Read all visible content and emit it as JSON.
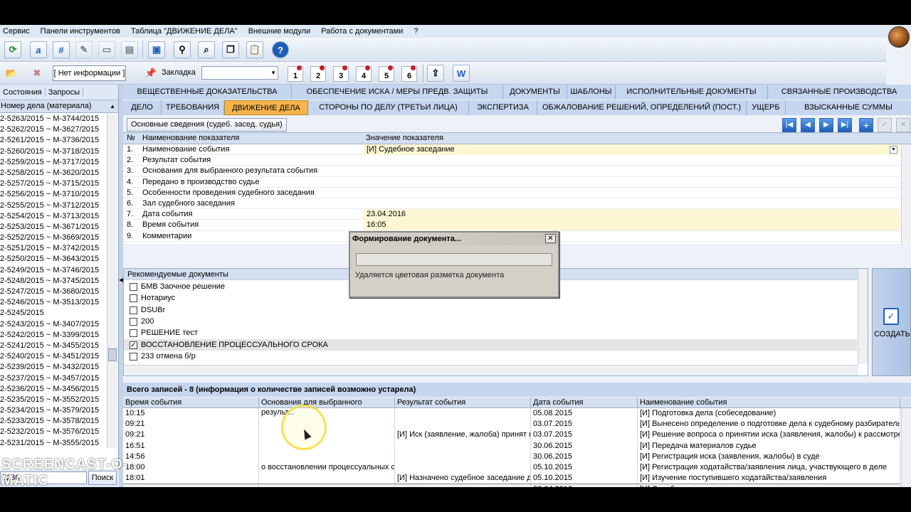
{
  "menu": [
    "Сервис",
    "Панели инструментов",
    "Таблица \"ДВИЖЕНИЕ ДЕЛА\"",
    "Внешние модули",
    "Работа с документами",
    "?"
  ],
  "toolbar": {
    "no_info": "[ Нет информации ]",
    "bookmark_label": "Закладка",
    "bookmark_value": "",
    "pin_numbers": [
      "1",
      "2",
      "3",
      "4",
      "5",
      "6"
    ]
  },
  "left": {
    "tabs": [
      "Состояния",
      "Запросы"
    ],
    "header": "Номер дела (материала)",
    "items": [
      "2-5263/2015 ~ М-3744/2015",
      "2-5262/2015 ~ М-3627/2015",
      "2-5261/2015 ~ М-3736/2015",
      "2-5260/2015 ~ М-3718/2015",
      "2-5259/2015 ~ М-3717/2015",
      "2-5258/2015 ~ М-3620/2015",
      "2-5257/2015 ~ М-3715/2015",
      "2-5256/2015 ~ М-3710/2015",
      "2-5255/2015 ~ М-3712/2015",
      "2-5254/2015 ~ М-3713/2015",
      "2-5253/2015 ~ М-3671/2015",
      "2-5252/2015 ~ М-3669/2015",
      "2-5251/2015 ~ М-3742/2015",
      "2-5250/2015 ~ М-3643/2015",
      "2-5249/2015 ~ М-3746/2015",
      "2-5248/2015 ~ М-3745/2015",
      "2-5247/2015 ~ М-3680/2015",
      "2-5246/2015 ~ М-3513/2015",
      "2-5245/2015",
      "2-5243/2015 ~ М-3407/2015",
      "2-5242/2015 ~ М-3399/2015",
      "2-5241/2015 ~ М-3455/2015",
      "2-5240/2015 ~ М-3451/2015",
      "2-5239/2015 ~ М-3432/2015",
      "2-5237/2015 ~ М-3457/2015",
      "2-5236/2015 ~ М-3456/2015",
      "2-5235/2015 ~ М-3552/2015",
      "2-5234/2015 ~ М-3579/2015",
      "2-5233/2015 ~ М-3578/2015",
      "2-5232/2015 ~ М-3576/2015",
      "2-5231/2015 ~ М-3555/2015",
      "2-5230/2015"
    ],
    "search_value": "5230",
    "search_button": "Поиск"
  },
  "tabs_row1": [
    "ВЕЩЕСТВЕННЫЕ ДОКАЗАТЕЛЬСТВА",
    "ОБЕСПЕЧЕНИЕ ИСКА / МЕРЫ ПРЕДВ. ЗАЩИТЫ",
    "ДОКУМЕНТЫ",
    "ШАБЛОНЫ",
    "ИСПОЛНИТЕЛЬНЫЕ ДОКУМЕНТЫ",
    "СВЯЗАННЫЕ ПРОИЗВОДСТВА"
  ],
  "tabs_row2": [
    "ДЕЛО",
    "ТРЕБОВАНИЯ",
    "ДВИЖЕНИЕ ДЕЛА",
    "СТОРОНЫ ПО ДЕЛУ (ТРЕТЬИ ЛИЦА)",
    "ЭКСПЕРТИЗА",
    "ОБЖАЛОВАНИЕ РЕШЕНИЙ, ОПРЕДЕЛЕНИЙ (ПОСТ.)",
    "УЩЕРБ",
    "ВЗЫСКАННЫЕ СУММЫ"
  ],
  "subtab": "Основные сведения (судеб. засед. судья)",
  "grid": {
    "col_no": "№",
    "col_name": "Наименование показателя",
    "col_value": "Значение показателя",
    "rows": [
      {
        "n": "1.",
        "name": "Наименование события",
        "value": "[И] Судебное заседание"
      },
      {
        "n": "2.",
        "name": "Результат события",
        "value": ""
      },
      {
        "n": "3.",
        "name": "Основания для выбранного результата события",
        "value": ""
      },
      {
        "n": "4.",
        "name": "Передано в производство судье",
        "value": ""
      },
      {
        "n": "5.",
        "name": "Особенности проведения судебного заседания",
        "value": ""
      },
      {
        "n": "6.",
        "name": "Зал судебного заседания",
        "value": ""
      },
      {
        "n": "7.",
        "name": "Дата события",
        "value": "23.04.2016"
      },
      {
        "n": "8.",
        "name": "Время события",
        "value": "16:05"
      },
      {
        "n": "9.",
        "name": "Комментарии",
        "value": ""
      }
    ]
  },
  "recommended": {
    "header": "Рекомендуемые документы",
    "items": [
      {
        "label": "БМВ Заочное решение",
        "checked": false
      },
      {
        "label": "Нотариус",
        "checked": false
      },
      {
        "label": "DSUBr",
        "checked": false
      },
      {
        "label": "200",
        "checked": false
      },
      {
        "label": "РЕШЕНИЕ тест",
        "checked": false
      },
      {
        "label": "ВОССТАНОВЛЕНИЕ ПРОЦЕССУАЛЬНОГО СРОКА",
        "checked": true
      },
      {
        "label": "233 отмена б/р",
        "checked": false
      }
    ],
    "create_label": "СОЗДАТЬ"
  },
  "events": {
    "total": "Всего записей - 8 (информация о количестве записей возможно устарела)",
    "columns": [
      "Время события",
      "Основания для выбранного результ...",
      "Результат события",
      "Дата события",
      "Наименование события"
    ],
    "rows": [
      [
        "10:15",
        "",
        "",
        "05.08.2015",
        "[И] Подготовка дела (собеседование)"
      ],
      [
        "09:21",
        "",
        "",
        "03.07.2015",
        "[И] Вынесено определение о подготовке дела к судебному разбирательству"
      ],
      [
        "09:21",
        "",
        "[И] Иск (заявление, жалоба) принят к",
        "03.07.2015",
        "[И] Решение вопроса о принятии иска (заявления, жалобы) к рассмотрению"
      ],
      [
        "16:51",
        "",
        "",
        "30.06.2015",
        "[И] Передача материалов судье"
      ],
      [
        "14:56",
        "",
        "",
        "30.06.2015",
        "[И] Регистрация иска (заявления, жалобы) в суде"
      ],
      [
        "18:00",
        "о восстановлении процессуальных сро",
        "",
        "05.10.2015",
        "[И] Регистрация ходатайства/заявления лица, участвующего в деле"
      ],
      [
        "18:01",
        "",
        "[И] Назначено судебное заседание дл",
        "05.10.2015",
        "[И] Изучение поступившего ходатайства/заявления"
      ],
      [
        "",
        "",
        "",
        "23.04.2016",
        "[И] Судебное заседание"
      ]
    ]
  },
  "dialog": {
    "title": "Формирование документа...",
    "message": "Удаляется цветовая разметка документа"
  },
  "watermark": {
    "line1": "RECORDED WITH",
    "line2": "SCREENCAST-O-MATIC"
  }
}
